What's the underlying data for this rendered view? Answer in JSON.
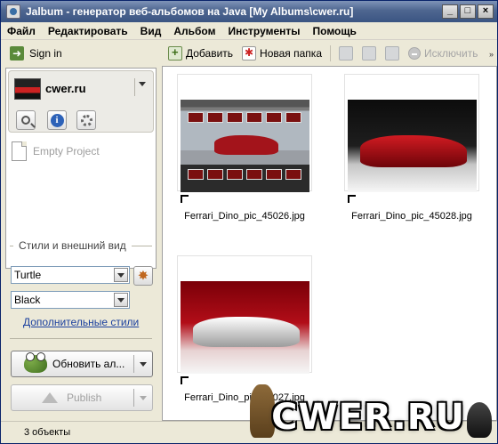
{
  "window": {
    "title": "Jalbum - генератор веб-альбомов на Java [My Albums\\cwer.ru]",
    "buttons": [
      "_",
      "□",
      "×"
    ]
  },
  "menu": [
    "Файл",
    "Редактировать",
    "Вид",
    "Альбом",
    "Инструменты",
    "Помощь"
  ],
  "sidebar": {
    "signin": "Sign in",
    "project_name": "cwer.ru",
    "empty_project": "Empty Project",
    "styles_section": "Стили и внешний вид",
    "style_value": "Turtle",
    "variant_value": "Black",
    "more_styles_link": "Дополнительные стили",
    "update_button": "Обновить ал...",
    "publish_button": "Publish"
  },
  "toolbar": {
    "add": "Добавить",
    "new_folder": "Новая папка",
    "exclude": "Исключить"
  },
  "files": [
    {
      "name": "Ferrari_Dino_pic_45026.jpg"
    },
    {
      "name": "Ferrari_Dino_pic_45028.jpg"
    },
    {
      "name": "Ferrari_Dino_pic_45027.jpg"
    }
  ],
  "status": {
    "count": "3 объекты"
  },
  "watermark": "CWER.RU",
  "icons": {
    "signin": "signin-arrow-icon",
    "search": "search-icon",
    "info": "info-icon",
    "settings": "settings-icon",
    "turtle": "turtle-style-icon",
    "frog": "frog-icon",
    "publish": "publish-arrow-icon"
  }
}
